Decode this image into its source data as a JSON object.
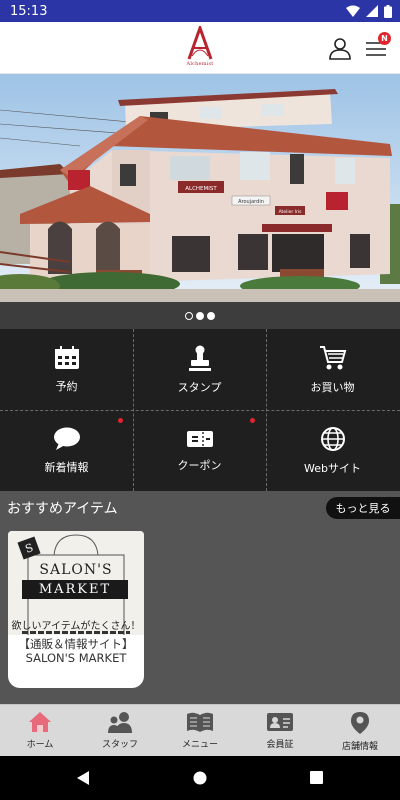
{
  "status_bar": {
    "time": "15:13"
  },
  "header": {
    "logo_caption": "Alchemist",
    "notification_badge": "N"
  },
  "hero": {
    "sign_main": "ALCHEMIST",
    "sign_small": "Aroujardin",
    "sign_side": "Atelier Iris",
    "carousel_active_index": 1,
    "carousel_count": 3
  },
  "menu_grid": [
    {
      "label": "予約",
      "icon": "calendar-icon"
    },
    {
      "label": "スタンプ",
      "icon": "stamp-icon"
    },
    {
      "label": "お買い物",
      "icon": "cart-icon"
    },
    {
      "label": "新着情報",
      "icon": "chat-bubble-icon",
      "has_new": true
    },
    {
      "label": "クーポン",
      "icon": "ticket-icon",
      "has_new": true
    },
    {
      "label": "Webサイト",
      "icon": "globe-icon"
    }
  ],
  "recommend": {
    "title": "おすすめアイテム",
    "more_label": "もっと見る",
    "items": [
      {
        "img_letter": "S",
        "img_line1": "SALON'S",
        "img_line2": "MARKET",
        "img_tag": "欲しいアイテムがたくさん！",
        "name": "【通販＆情報サイト】SALON'S MARKET"
      }
    ]
  },
  "tabbar": [
    {
      "label": "ホーム",
      "icon": "home-icon",
      "active": true
    },
    {
      "label": "スタッフ",
      "icon": "staff-icon"
    },
    {
      "label": "メニュー",
      "icon": "book-icon"
    },
    {
      "label": "会員証",
      "icon": "member-card-icon"
    },
    {
      "label": "店舗情報",
      "icon": "location-pin-icon"
    }
  ],
  "colors": {
    "status_bar": "#2b35a5",
    "brand_red": "#b8232f",
    "grid_bg": "#1f1f1f",
    "home_active": "#e8697a",
    "badge": "#e0262c"
  }
}
